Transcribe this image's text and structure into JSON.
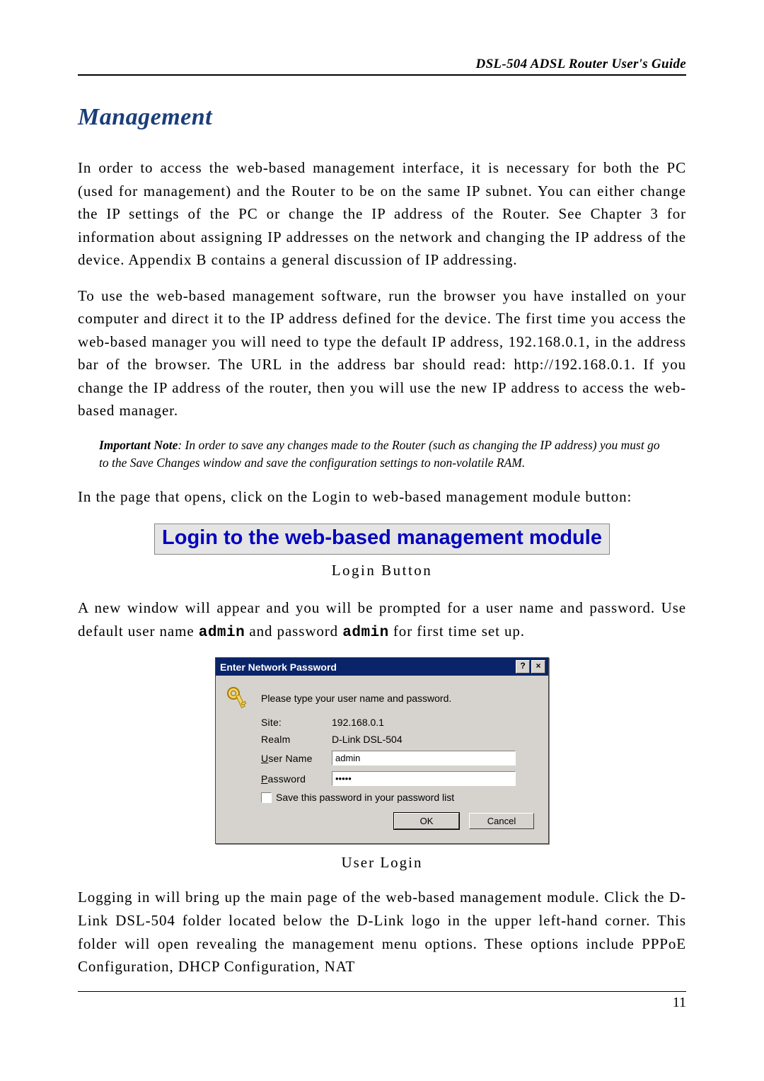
{
  "header": {
    "title": "DSL-504 ADSL Router User's Guide"
  },
  "section": {
    "heading": "Management"
  },
  "paragraphs": {
    "p1": "In order to access the web-based management interface, it is necessary for both the PC (used for management) and the Router to be on the same IP subnet. You can either change the IP settings of the PC or change the IP address of the Router. See Chapter 3 for information about assigning IP addresses on the network and changing the IP address of the device. Appendix B contains a general discussion of IP addressing.",
    "p2": "To use the web-based management software, run the browser you have installed on your computer and direct it to the IP address defined for the device. The first time you access the web-based manager you will need to type the default IP address, 192.168.0.1, in the address bar of the browser. The URL in the address bar should read: http://192.168.0.1. If you change the IP address of the router, then you will use the new IP address to access the web-based manager.",
    "p3": "In the page that opens, click on the Login to web-based management module button:",
    "p4_a": "A new window will appear and you will be prompted for a user name and password. Use default user name ",
    "p4_admin1": "admin",
    "p4_b": " and password ",
    "p4_admin2": "admin",
    "p4_c": " for first time set up.",
    "p5": "Logging in will bring up the main page of the web-based management module. Click the D-Link DSL-504 folder located below the D-Link logo in the upper left-hand corner. This folder will open revealing the management menu options. These options include PPPoE Configuration, DHCP Configuration, NAT"
  },
  "note": {
    "label": "Important Note",
    "text": ": In order to save any changes made to the Router (such as changing the IP address) you must go to the Save Changes window and save the configuration settings to non-volatile RAM."
  },
  "login_banner": {
    "text": "Login to the web-based management module",
    "caption": "Login Button"
  },
  "dialog": {
    "title": "Enter Network Password",
    "help_btn": "?",
    "close_btn": "×",
    "instruction": "Please type your user name and password.",
    "site_label": "Site:",
    "site_value": "192.168.0.1",
    "realm_label": "Realm",
    "realm_value": "D-Link DSL-504",
    "user_label_pre": "U",
    "user_label_post": "ser Name",
    "user_value": "admin",
    "pass_label_pre": "P",
    "pass_label_post": "assword",
    "pass_value": "•••••",
    "save_label_pre": "S",
    "save_label_post": "ave this password in your password list",
    "ok": "OK",
    "cancel": "Cancel",
    "caption": "User Login"
  },
  "footer": {
    "page": "11"
  }
}
